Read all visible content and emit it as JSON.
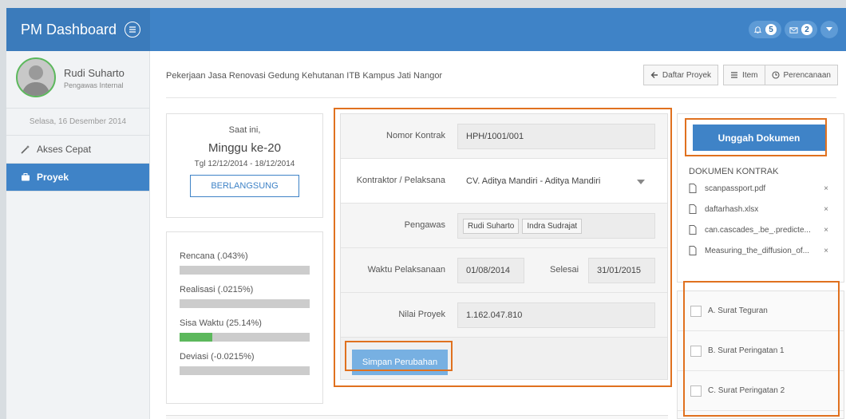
{
  "app": {
    "title": "PM Dashboard"
  },
  "notifications": {
    "bell_count": "5",
    "mail_count": "2"
  },
  "user": {
    "name": "Rudi Suharto",
    "role": "Pengawas Internal"
  },
  "sidebar": {
    "date": "Selasa, 16 Desember 2014",
    "items": [
      {
        "label": "Akses Cepat",
        "icon": "magic-wand-icon",
        "active": false
      },
      {
        "label": "Proyek",
        "icon": "briefcase-icon",
        "active": true
      }
    ]
  },
  "header": {
    "page_title": "Pekerjaan Jasa Renovasi Gedung Kehutanan ITB Kampus Jati Nangor",
    "buttons": {
      "back": "Daftar Proyek",
      "item": "Item",
      "plan": "Perencanaan"
    }
  },
  "status": {
    "now_label": "Saat ini,",
    "week": "Minggu ke-20",
    "date_range": "Tgl 12/12/2014 - 18/12/2014",
    "state": "BERLANGSUNG"
  },
  "progress": [
    {
      "label": "Rencana (.043%)",
      "fraction": 0.00043
    },
    {
      "label": "Realisasi (.0215%)",
      "fraction": 0.000215
    },
    {
      "label": "Sisa Waktu (25.14%)",
      "fraction": 0.2514
    },
    {
      "label": "Deviasi (-0.0215%)",
      "fraction": 0
    }
  ],
  "form": {
    "contract_number_label": "Nomor Kontrak",
    "contract_number": "HPH/1001/001",
    "contractor_label": "Kontraktor / Pelaksana",
    "contractor": "CV. Aditya Mandiri - Aditya Mandiri",
    "supervisor_label": "Pengawas",
    "supervisors": [
      "Rudi Suharto",
      "Indra Sudrajat"
    ],
    "period_label": "Waktu Pelaksanaan",
    "start_date": "01/08/2014",
    "end_label": "Selesai",
    "end_date": "31/01/2015",
    "value_label": "Nilai Proyek",
    "value": "1.162.047.810",
    "submit_label": "Simpan Perubahan"
  },
  "documents": {
    "upload_label": "Unggah Dokumen",
    "heading": "DOKUMEN KONTRAK",
    "files": [
      "scanpassport.pdf",
      "daftarhash.xlsx",
      "can.cascades_.be_.predicte...",
      "Measuring_the_diffusion_of..."
    ],
    "remove_glyph": "×"
  },
  "letters": [
    "A. Surat Teguran",
    "B. Surat Peringatan 1",
    "C. Surat Peringatan 2"
  ],
  "colors": {
    "primary": "#3f83c7",
    "highlight": "#e0711f",
    "progress": "#5cb85c"
  }
}
